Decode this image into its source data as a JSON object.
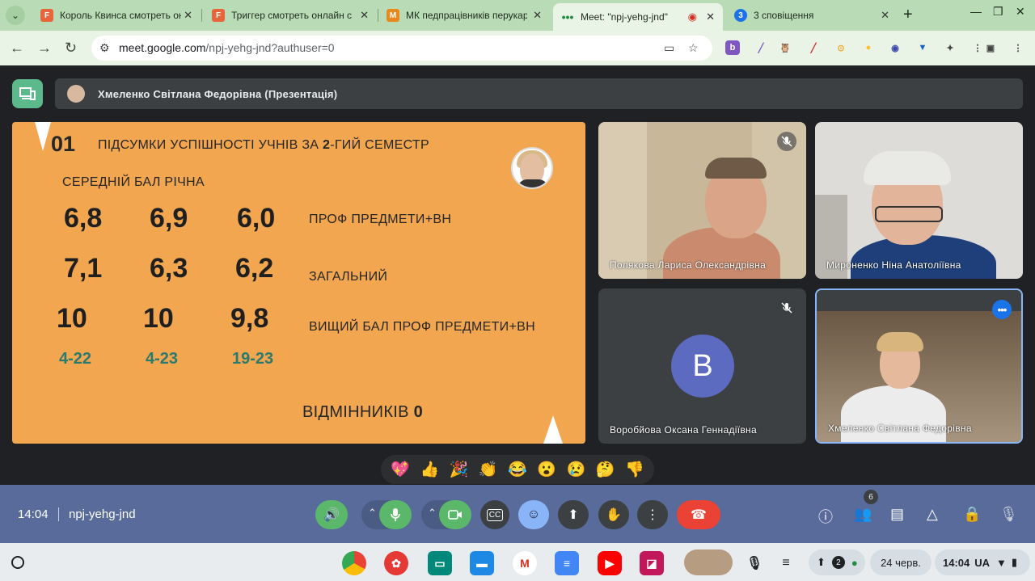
{
  "browser": {
    "tabs": [
      {
        "title": "Король Квинса смотреть онлайн",
        "favicon": "F",
        "color": "#e8643a"
      },
      {
        "title": "Триггер смотреть онлайн с",
        "favicon": "F",
        "color": "#e8643a"
      },
      {
        "title": "МК педпрацівників перукар",
        "favicon": "M",
        "color": "#e8891e"
      },
      {
        "title": "Meet: \"npj-yehg-jnd\"",
        "favicon": "•••",
        "color": "#1e8e3e"
      },
      {
        "title": "3 сповіщення",
        "favicon": "3",
        "color": "#1a73e8"
      }
    ],
    "new_tab": "+",
    "url_host": "meet.google.com",
    "url_path": "/npj-yehg-jnd?authuser=0"
  },
  "meet": {
    "presenter_banner": "Хмеленко Світлана Федорівна (Презентація)",
    "slide": {
      "number": "01",
      "title_pre": "ПІДСУМКИ УСПІШНОСТІ УЧНІВ ЗА ",
      "title_bold": "2",
      "title_post": "-ГИЙ СЕМЕСТР",
      "subtitle": "СЕРЕДНІЙ БАЛ РІЧНА",
      "rows": [
        {
          "values": [
            "6,8",
            "6,9",
            "6,0"
          ],
          "label": "ПРОФ ПРЕДМЕТИ+ВН"
        },
        {
          "values": [
            "7,1",
            "6,3",
            "6,2"
          ],
          "label": "ЗАГАЛЬНИЙ"
        },
        {
          "values": [
            "10",
            "10",
            "9,8"
          ],
          "label": "ВИЩИЙ БАЛ ПРОФ ПРЕДМЕТИ+ВН"
        }
      ],
      "groups": [
        "4-22",
        "4-23",
        "19-23"
      ],
      "excellent_label": "ВІДМІННИКІВ ",
      "excellent_value": "0"
    },
    "participants": [
      {
        "name": "Полякова Лариса Олександрівна",
        "muted": true
      },
      {
        "name": "Мироненко Ніна Анатоліївна",
        "muted": false
      },
      {
        "name": "Воробйова Оксана Геннадіївна",
        "muted": true,
        "initial": "B"
      },
      {
        "name": "Хмеленко Світлана Федорівна",
        "muted": false
      }
    ],
    "reactions": [
      "💖",
      "👍",
      "🎉",
      "👏",
      "😂",
      "😮",
      "😢",
      "🤔",
      "👎"
    ],
    "controls": {
      "time": "14:04",
      "meeting_code": "npj-yehg-jnd",
      "people_count": "6"
    }
  },
  "shelf": {
    "date": "24 черв.",
    "time": "14:04",
    "lang": "UA",
    "notif_count": "2"
  }
}
